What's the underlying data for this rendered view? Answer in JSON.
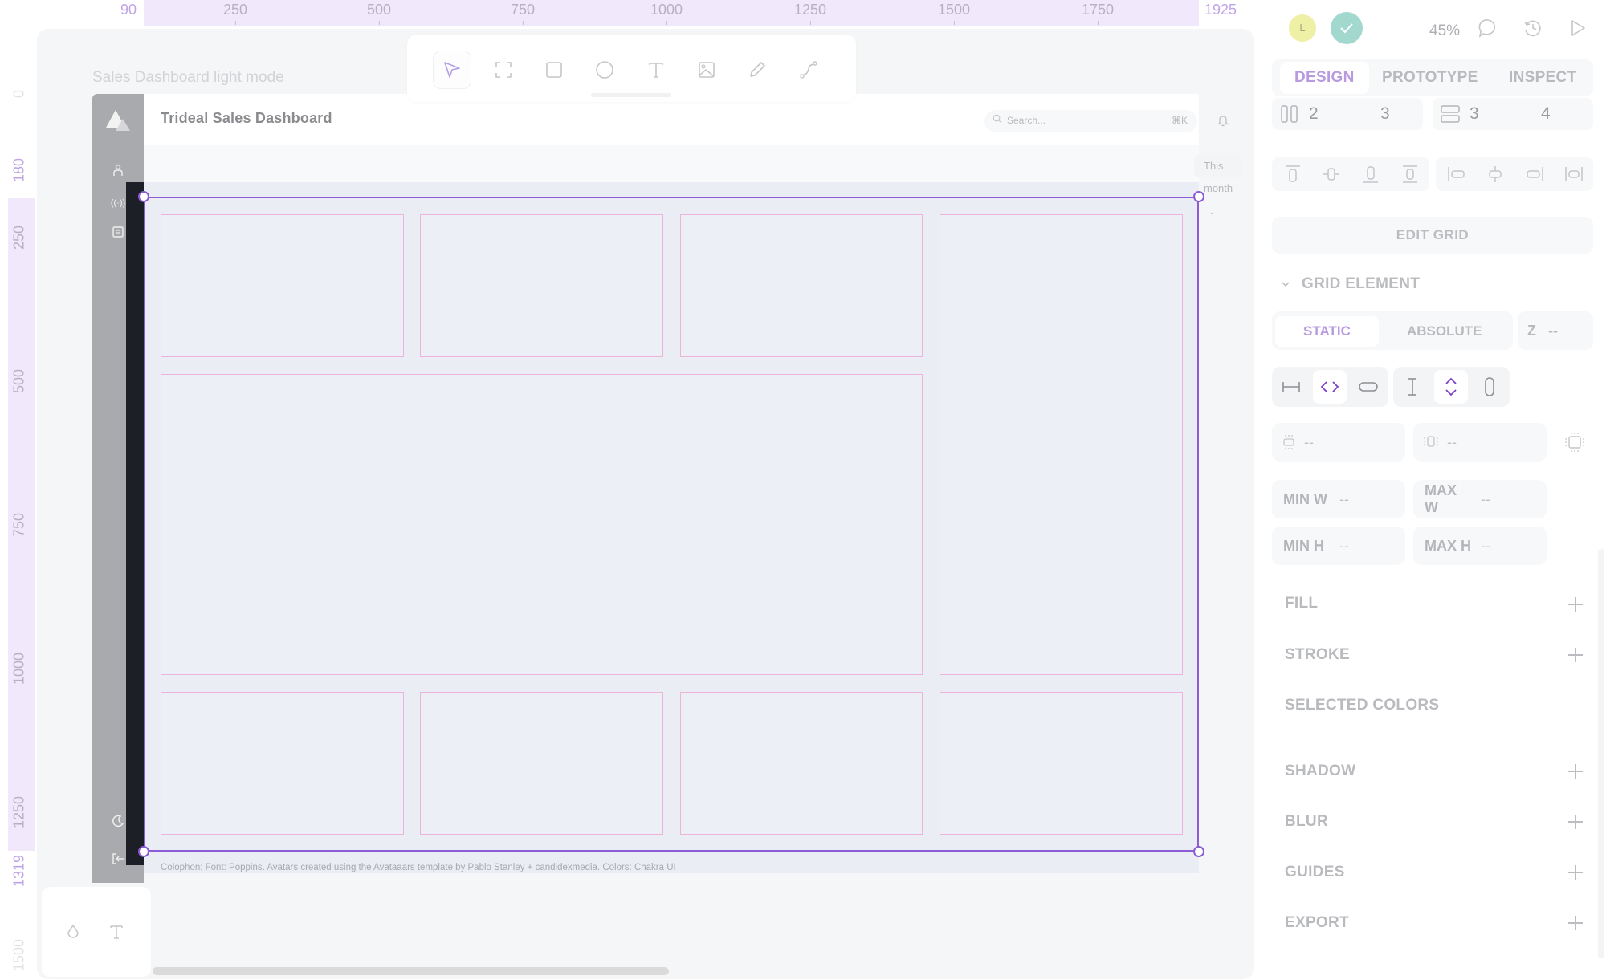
{
  "rulers": {
    "horizontal": [
      "90",
      "250",
      "500",
      "750",
      "1000",
      "1250",
      "1500",
      "1750",
      "1925"
    ],
    "vertical": [
      "0",
      "180",
      "250",
      "500",
      "750",
      "1000",
      "1250",
      "1319",
      "1500"
    ]
  },
  "canvas": {
    "frame_label": "Sales Dashboard light mode"
  },
  "toolbar": {
    "tools": [
      {
        "name": "move-tool",
        "label": "Move"
      },
      {
        "name": "frame-tool",
        "label": "Frame"
      },
      {
        "name": "rectangle-tool",
        "label": "Rectangle"
      },
      {
        "name": "ellipse-tool",
        "label": "Ellipse"
      },
      {
        "name": "text-tool",
        "label": "Text"
      },
      {
        "name": "image-tool",
        "label": "Image"
      },
      {
        "name": "pencil-tool",
        "label": "Pencil"
      },
      {
        "name": "path-tool",
        "label": "Path"
      }
    ],
    "active_tool": "move-tool"
  },
  "dashboard": {
    "title": "Trideal Sales Dashboard",
    "search_placeholder": "Search...",
    "search_shortcut": "⌘K",
    "period_select": "This month",
    "colophon": "Colophon: Font: Poppins. Avatars created using the Avataaars template by Pablo Stanley + candidexmedia. Colors: Chakra UI",
    "grid": {
      "columns": 4,
      "rows": 3
    }
  },
  "right_panel": {
    "avatar_initial": "L",
    "zoom_level": "45%",
    "tabs": [
      "DESIGN",
      "PROTOTYPE",
      "INSPECT"
    ],
    "active_tab": "DESIGN",
    "grid_layout": {
      "columns_value": "2",
      "columns_gap": "3",
      "rows_value": "3",
      "rows_gap": "4"
    },
    "edit_grid_label": "EDIT GRID",
    "grid_element_title": "GRID ELEMENT",
    "position_tabs": [
      "STATIC",
      "ABSOLUTE"
    ],
    "active_position": "STATIC",
    "z_label": "Z",
    "z_value": "--",
    "margin_vertical": "--",
    "margin_horizontal": "--",
    "min_w_label": "MIN W",
    "min_w_value": "--",
    "max_w_label": "MAX W",
    "max_w_value": "--",
    "min_h_label": "MIN H",
    "min_h_value": "--",
    "max_h_label": "MAX H",
    "max_h_value": "--",
    "sections": {
      "fill": "FILL",
      "stroke": "STROKE",
      "selected_colors": "SELECTED COLORS",
      "shadow": "SHADOW",
      "blur": "BLUR",
      "guides": "GUIDES",
      "export": "EXPORT"
    }
  },
  "colors": {
    "accent": "#8b5cd6",
    "ruler_highlight": "#f1e8fb",
    "grid_cell_border": "#ecb3dd",
    "sync_ok": "#a3d8cf",
    "avatar": "#eef0a6"
  }
}
